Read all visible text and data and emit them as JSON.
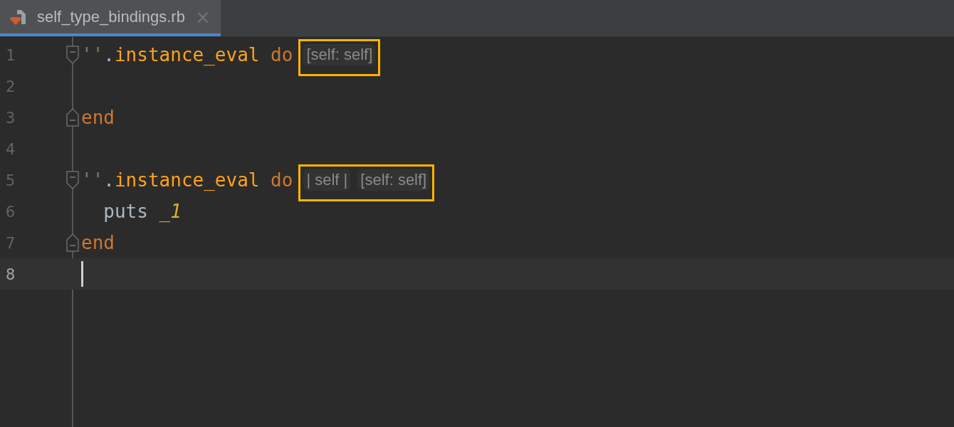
{
  "tab": {
    "title": "self_type_bindings.rb",
    "close": "×",
    "selected": true
  },
  "lines": [
    {
      "number": "1",
      "kind": "fold_start",
      "current": false,
      "tokens": [
        {
          "kind": "string",
          "text": "''"
        },
        {
          "kind": "method_call",
          "text": ".instance_eval"
        },
        {
          "kind": "keyword",
          "text": "do"
        }
      ],
      "hints": {
        "highlighted": true,
        "items": [
          "[self: self]"
        ]
      }
    },
    {
      "number": "2",
      "kind": "plain",
      "current": false
    },
    {
      "number": "3",
      "kind": "fold_end",
      "current": false,
      "tokens": [
        {
          "kind": "keyword",
          "text": "end"
        }
      ]
    },
    {
      "number": "4",
      "kind": "plain",
      "current": false
    },
    {
      "number": "5",
      "kind": "fold_start",
      "current": false,
      "tokens": [
        {
          "kind": "string",
          "text": "''"
        },
        {
          "kind": "method_call",
          "text": ".instance_eval"
        },
        {
          "kind": "keyword",
          "text": "do"
        }
      ],
      "hints": {
        "highlighted": true,
        "items": [
          "| self |",
          "[self: self]"
        ]
      }
    },
    {
      "number": "6",
      "kind": "plain",
      "current": false,
      "tokens": [
        {
          "kind": "ident",
          "text": "puts"
        },
        {
          "kind": "param",
          "text": "_1"
        }
      ]
    },
    {
      "number": "7",
      "kind": "fold_end",
      "current": false,
      "tokens": [
        {
          "kind": "keyword",
          "text": "end"
        }
      ]
    },
    {
      "number": "8",
      "kind": "plain",
      "current": true
    }
  ]
}
